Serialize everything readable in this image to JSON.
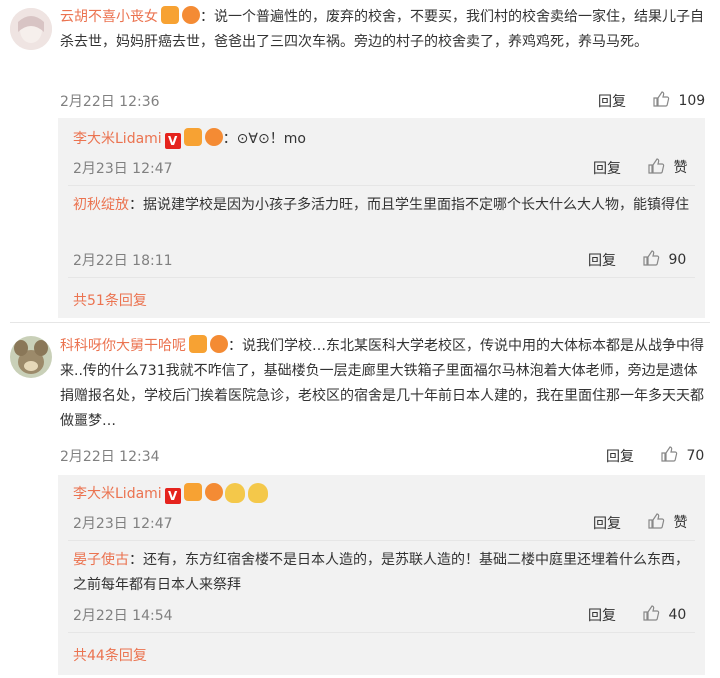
{
  "comments": [
    {
      "user": "云胡不喜小丧女",
      "text": "：说一个普遍性的，废弃的校舍，不要买，我们村的校舍卖给一家住，结果儿子自杀去世，妈妈肝癌去世，爸爸出了三四次车祸。旁边的村子的校舍卖了，养鸡鸡死，养马马死。",
      "time": "2月22日 12:36",
      "reply_label": "回复",
      "likes": "109",
      "replies": [
        {
          "user": "李大米Lidami",
          "text": "：⊙∀⊙！mo",
          "time": "2月23日 12:47",
          "reply_label": "回复",
          "likes": "赞"
        },
        {
          "user": "初秋绽放",
          "text": "：据说建学校是因为小孩子多活力旺，而且学生里面指不定哪个长大什么大人物，能镇得住",
          "time": "2月22日 18:11",
          "reply_label": "回复",
          "likes": "90"
        }
      ],
      "more": "共51条回复"
    },
    {
      "user": "科科呀你大舅干哈呢",
      "text": "：说我们学校…东北某医科大学老校区，传说中用的大体标本都是从战争中得来..传的什么731我就不咋信了，基础楼负一层走廊里大铁箱子里面福尔马林泡着大体老师，旁边是遗体捐赠报名处，学校后门挨着医院急诊，老校区的宿舍是几十年前日本人建的，我在里面住那一年多天天都做噩梦…",
      "time": "2月22日 12:34",
      "reply_label": "回复",
      "likes": "70",
      "replies": [
        {
          "user": "李大米Lidami",
          "text": "",
          "time": "2月23日 12:47",
          "reply_label": "回复",
          "likes": "赞"
        },
        {
          "user": "晏子使古",
          "text": "：还有，东方红宿舍楼不是日本人造的，是苏联人造的！基础二楼中庭里还埋着什么东西，之前每年都有日本人来祭拜",
          "time": "2月22日 14:54",
          "reply_label": "回复",
          "likes": "40"
        }
      ],
      "more": "共44条回复"
    }
  ],
  "colors": {
    "name": "#eb7350",
    "reply_bg": "#f2f2f2",
    "meta": "#808080"
  }
}
